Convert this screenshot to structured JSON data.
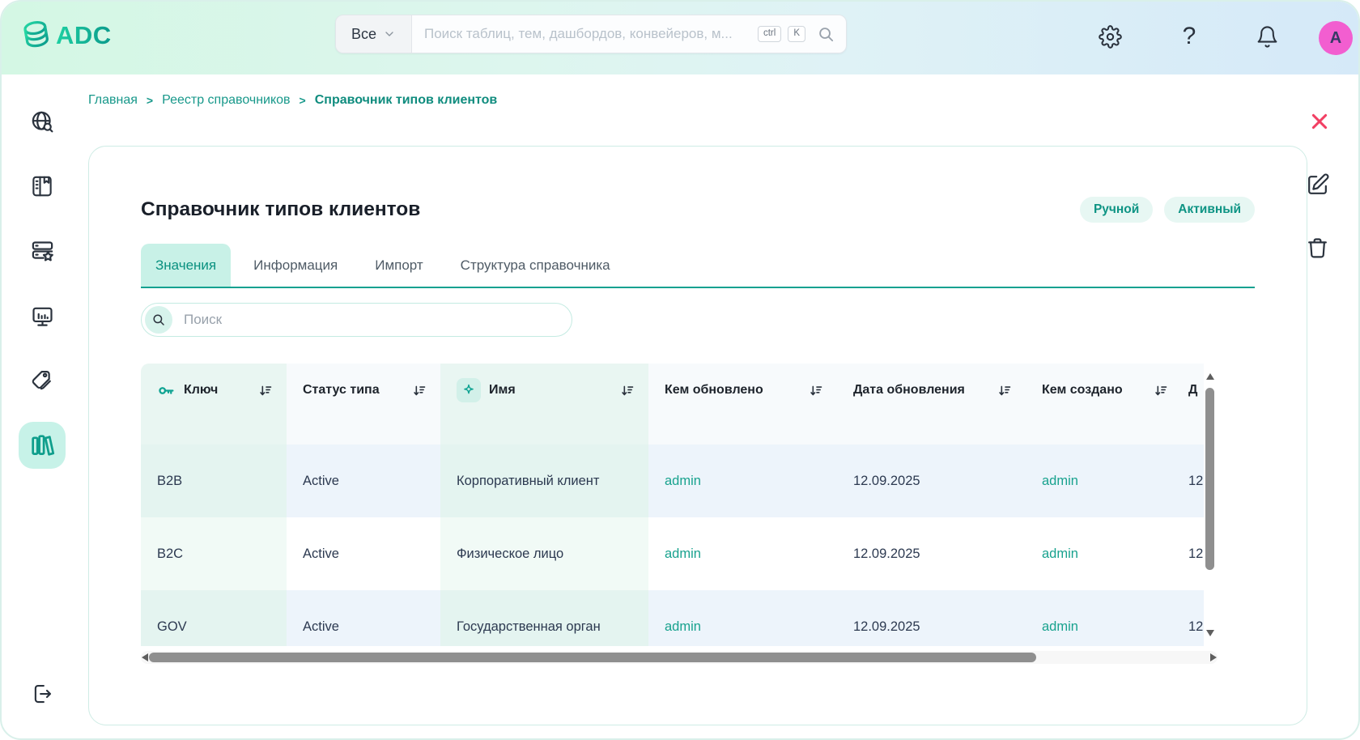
{
  "header": {
    "logo_text": "ADC",
    "search_scope": "Все",
    "search_placeholder": "Поиск таблиц, тем, дашбордов, конвейеров, м...",
    "shortcut": [
      "ctrl",
      "K"
    ],
    "avatar_letter": "A"
  },
  "breadcrumb": {
    "separator": ">",
    "items": [
      "Главная",
      "Реестр справочников",
      "Справочник типов клиентов"
    ]
  },
  "sidebar": {
    "items": [
      "global-search",
      "journal",
      "data-registry",
      "dashboards",
      "tags",
      "dictionaries"
    ],
    "active_item": "dictionaries",
    "bottom_item": "logout"
  },
  "page": {
    "title": "Справочник типов клиентов",
    "badges": [
      "Ручной",
      "Активный"
    ],
    "tabs": [
      "Значения",
      "Информация",
      "Импорт",
      "Структура справочника"
    ],
    "active_tab": "Значения",
    "search_placeholder": "Поиск"
  },
  "table": {
    "columns": [
      "Ключ",
      "Статус типа",
      "Имя",
      "Кем обновлено",
      "Дата обновления",
      "Кем создано",
      "Д"
    ],
    "rows": [
      {
        "key": "B2B",
        "status": "Active",
        "name": "Корпоративный клиент",
        "updated_by": "admin",
        "updated_date": "12.09.2025",
        "created_by": "admin",
        "created_date": "12"
      },
      {
        "key": "B2C",
        "status": "Active",
        "name": "Физическое лицо",
        "updated_by": "admin",
        "updated_date": "12.09.2025",
        "created_by": "admin",
        "created_date": "12"
      },
      {
        "key": "GOV",
        "status": "Active",
        "name": "Государственная орган",
        "updated_by": "admin",
        "updated_date": "12.09.2025",
        "created_by": "admin",
        "created_date": "12"
      }
    ]
  },
  "colors": {
    "accent": "#12A190",
    "badge_bg": "#E7F7F3",
    "active_tab_bg": "#C8F1E7",
    "row_alt": "#EDF4FB",
    "link": "#18A28E",
    "close": "#F23F63",
    "avatar": "#F25ED0"
  }
}
